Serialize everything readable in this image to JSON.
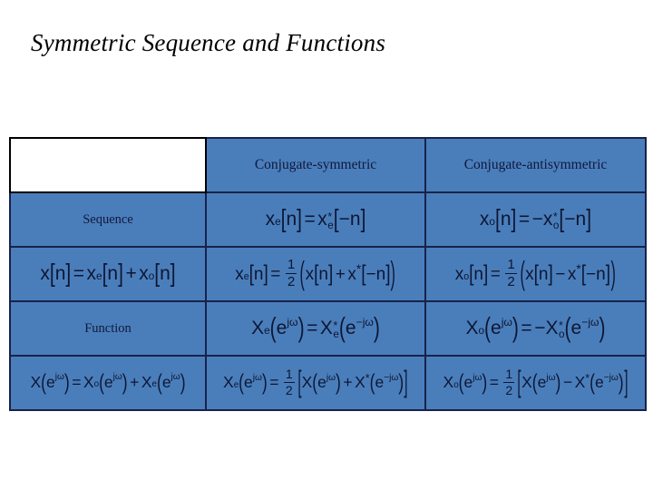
{
  "slide": {
    "title": "Symmetric Sequence and Functions",
    "background_color": "#ffffff",
    "title_color": "#000000"
  },
  "table": {
    "cell_fill_color": "#4a7ebb",
    "border_color": "#17224a",
    "text_color": "#10193a",
    "columns": [
      "",
      "Conjugate-symmetric",
      "Conjugate-antisymmetric"
    ],
    "rows": [
      {
        "label": "",
        "kind": "header",
        "cells": [
          "",
          "Conjugate-symmetric",
          "Conjugate-antisymmetric"
        ]
      },
      {
        "label": "Sequence",
        "kind": "label",
        "cells": [
          "Sequence",
          "x_e[n] = x*_e[-n]",
          "x_o[n] = -x*_o[-n]"
        ]
      },
      {
        "label": "",
        "kind": "equation",
        "cells": [
          "x[n] = x_e[n] + x_o[n]",
          "x_e[n] = 1/2 ( x[n] + x*[-n] )",
          "x_o[n] = 1/2 ( x[n] - x*[-n] )"
        ]
      },
      {
        "label": "Function",
        "kind": "label",
        "cells": [
          "Function",
          "X_e(e^jw) = X*_e(e^-jw)",
          "X_o(e^jw) = -X*_o(e^-jw)"
        ]
      },
      {
        "label": "",
        "kind": "equation",
        "cells": [
          "X(e^jw) = X_o(e^jw) + X_e(e^jw)",
          "X_e(e^jw) = 1/2 [ X(e^jw) + X*(e^-jw) ]",
          "X_o(e^jw) = 1/2 [ X(e^jw) - X*(e^-jw) ]"
        ]
      }
    ],
    "labels": {
      "sequence": "Sequence",
      "function": "Function",
      "conjugate_symmetric": "Conjugate-symmetric",
      "conjugate_antisymmetric": "Conjugate-antisymmetric"
    },
    "symbols": {
      "one": "1",
      "two": "2",
      "n": "n",
      "minus": "−",
      "plus": "+",
      "equals": "=",
      "star": "*",
      "omega": "ω",
      "j": "j",
      "e": "e",
      "x_lower": "x",
      "x_upper": "X",
      "sub_e": "e",
      "sub_o": "o",
      "bracket_open": "[",
      "bracket_close": "]",
      "paren_open": "(",
      "paren_close": ")"
    }
  }
}
